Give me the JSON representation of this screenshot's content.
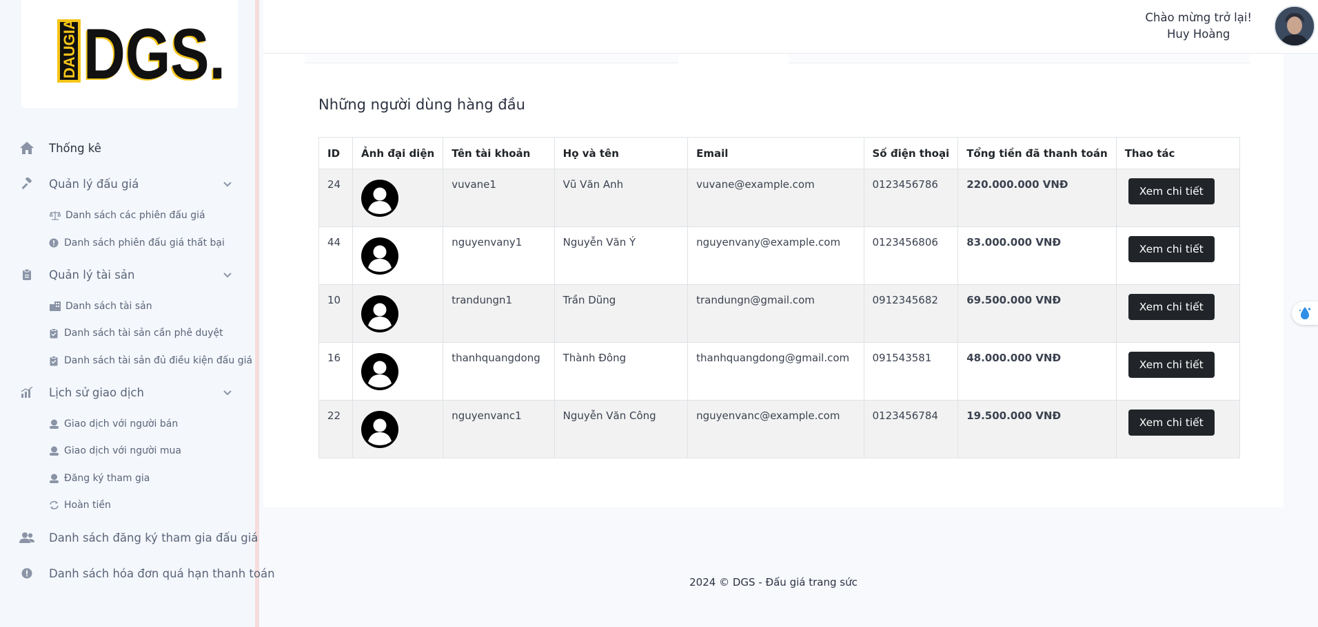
{
  "brand": {
    "logo_text": "DGS.",
    "logo_vertical": "DAUGIA"
  },
  "sidebar": {
    "items": [
      {
        "label": "Thống kê",
        "icon": "home-icon"
      },
      {
        "label": "Quản lý đấu giá",
        "icon": "gavel-icon",
        "children": [
          {
            "label": "Danh sách các phiên đấu giá",
            "icon": "scale-icon"
          },
          {
            "label": "Danh sách phiên đấu giá thất bại",
            "icon": "alert-circle-icon"
          }
        ]
      },
      {
        "label": "Quản lý tài sản",
        "icon": "clipboard-icon",
        "children": [
          {
            "label": "Danh sách tài sản",
            "icon": "building-icon"
          },
          {
            "label": "Danh sách tài sản cần phê duyệt",
            "icon": "clipboard-check-icon"
          },
          {
            "label": "Danh sách tài sản đủ điều kiện đấu giá",
            "icon": "clipboard-check-icon"
          }
        ]
      },
      {
        "label": "Lịch sử giao dịch",
        "icon": "chart-icon",
        "children": [
          {
            "label": "Giao dịch với người bán",
            "icon": "user-shield-icon"
          },
          {
            "label": "Giao dịch với người mua",
            "icon": "user-shield-icon"
          },
          {
            "label": "Đăng ký tham gia",
            "icon": "user-shield-icon"
          },
          {
            "label": "Hoàn tiền",
            "icon": "refresh-icon"
          }
        ]
      },
      {
        "label": "Danh sách đăng ký tham gia đấu giá",
        "icon": "users-icon"
      },
      {
        "label": "Danh sách hóa đơn quá hạn thanh toán",
        "icon": "alert-circle-icon"
      }
    ]
  },
  "header": {
    "welcome": "Chào mừng trở lại!",
    "user_name": "Huy Hoàng"
  },
  "main": {
    "title": "Những người dùng hàng đầu",
    "table": {
      "columns": [
        "ID",
        "Ảnh đại diện",
        "Tên tài khoản",
        "Họ và tên",
        "Email",
        "Số điện thoại",
        "Tổng tiền đã thanh toán",
        "Thao tác"
      ],
      "rows": [
        {
          "id": "24",
          "username": "vuvane1",
          "full_name": "Vũ Văn Anh",
          "email": "vuvane@example.com",
          "phone": "0123456786",
          "total": "220.000.000 VNĐ",
          "action": "Xem chi tiết"
        },
        {
          "id": "44",
          "username": "nguyenvany1",
          "full_name": "Nguyễn Văn Ý",
          "email": "nguyenvany@example.com",
          "phone": "0123456806",
          "total": "83.000.000 VNĐ",
          "action": "Xem chi tiết"
        },
        {
          "id": "10",
          "username": "trandungn1",
          "full_name": "Trần Dũng",
          "email": "trandungn@gmail.com",
          "phone": "0912345682",
          "total": "69.500.000 VNĐ",
          "action": "Xem chi tiết"
        },
        {
          "id": "16",
          "username": "thanhquangdong",
          "full_name": "Thành Đông",
          "email": "thanhquangdong@gmail.com",
          "phone": "091543581",
          "total": "48.000.000 VNĐ",
          "action": "Xem chi tiết"
        },
        {
          "id": "22",
          "username": "nguyenvanc1",
          "full_name": "Nguyễn Văn Công",
          "email": "nguyenvanc@example.com",
          "phone": "0123456784",
          "total": "19.500.000 VNĐ",
          "action": "Xem chi tiết"
        }
      ]
    }
  },
  "footer": {
    "text": "2024 © DGS - Đấu giá trang sức"
  },
  "colors": {
    "sidebar_bg": "#f4f7fc",
    "button_bg": "#212529",
    "logo_yellow": "#f5c518",
    "row_stripe": "#f2f2f2"
  }
}
